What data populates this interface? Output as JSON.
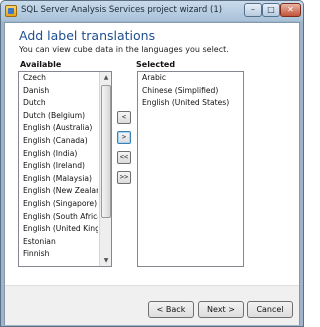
{
  "window": {
    "title": "SQL Server Analysis Services project wizard (1)",
    "controls": {
      "minimize": "–",
      "maximize": "□",
      "close": "✕"
    }
  },
  "header": {
    "title": "Add label translations",
    "subtitle": "You can view cube data in the languages you select."
  },
  "available": {
    "label": "Available",
    "items": [
      "Czech",
      "Danish",
      "Dutch",
      "Dutch (Belgium)",
      "English (Australia)",
      "English (Canada)",
      "English (India)",
      "English (Ireland)",
      "English (Malaysia)",
      "English (New Zealand)",
      "English (Singapore)",
      "English (South Africa)",
      "English (United Kingdom)",
      "Estonian",
      "Finnish"
    ]
  },
  "selected": {
    "label": "Selected",
    "items": [
      "Arabic",
      "Chinese (Simplified)",
      "English (United States)"
    ]
  },
  "move_buttons": {
    "remove": "<",
    "add": ">",
    "remove_all": "<<",
    "add_all": ">>"
  },
  "scroll": {
    "up": "▲",
    "down": "▼"
  },
  "footer": {
    "back": "< Back",
    "next": "Next >",
    "cancel": "Cancel"
  }
}
